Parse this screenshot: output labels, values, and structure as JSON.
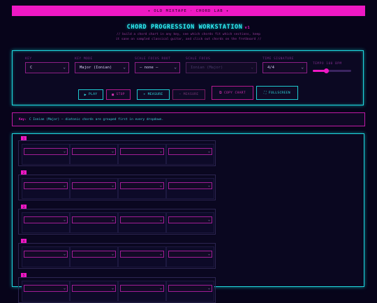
{
  "banner": "✦ OLD MIXTAPE · CHORD LAB ✦",
  "title": "CHORD PROGRESSION WORKSTATION",
  "version": "v1",
  "subtitle_lines": [
    "// build a chord chart in any key, see which chords fit which sections, keep",
    "it sane on sampled classical guitar, and click out chords on the fretboard //"
  ],
  "controls": {
    "key": {
      "label": "KEY",
      "value": "C"
    },
    "key_mode": {
      "label": "KEY MODE",
      "value": "Major (Ionian)"
    },
    "scale_focus_root": {
      "label": "SCALE FOCUS ROOT",
      "value": "— none —"
    },
    "scale_focus": {
      "label": "SCALE FOCUS",
      "value": "Ionian (Major)"
    },
    "time_signature": {
      "label": "TIME SIGNATURE",
      "value": "4/4"
    },
    "tempo": {
      "label": "TEMPO 100 BPM",
      "level": 0.35
    }
  },
  "buttons": {
    "play": "PLAY",
    "stop": "STOP",
    "add_measure": "+ MEASURE",
    "remove_measure": "− MEASURE",
    "copy_chart": "COPY CHART",
    "fullscreen": "FULLSCREEN"
  },
  "keybar": {
    "label": "Key:",
    "text": "C Ionian (Major) — diatonic chords are grouped first in every dropdown."
  },
  "measures": [
    {
      "number": "1"
    },
    {
      "number": "2"
    },
    {
      "number": "3"
    },
    {
      "number": "4"
    },
    {
      "number": "5"
    }
  ],
  "colors": {
    "accent_pink": "#ee18c4",
    "accent_cyan": "#2ff0f6",
    "background": "#07041a"
  }
}
